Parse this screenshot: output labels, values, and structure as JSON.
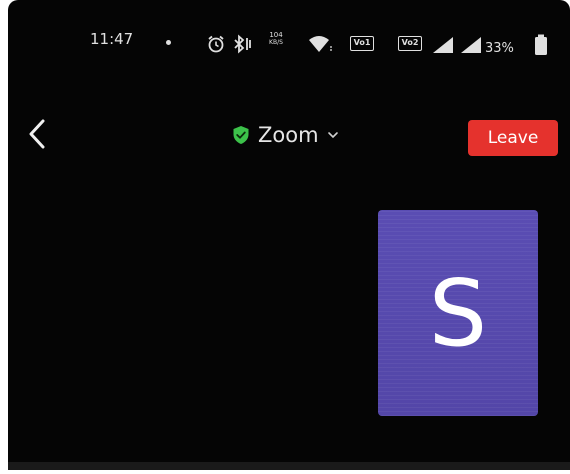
{
  "status_bar": {
    "time": "11:47",
    "net_speed_value": "104",
    "net_speed_unit": "KB/S",
    "sim1_label": "Vo1",
    "sim2_label": "Vo2",
    "battery_percent": "33%",
    "icons": [
      "alarm-icon",
      "bluetooth-icon",
      "wifi-icon",
      "signal-icon",
      "signal-icon",
      "battery-icon"
    ]
  },
  "header": {
    "meeting_name": "Zoom",
    "leave_label": "Leave"
  },
  "participant": {
    "initial": "S"
  },
  "colors": {
    "background": "#050505",
    "leave": "#e5322d",
    "shield": "#3cc24a",
    "avatar_tile": "#5b4bb0"
  }
}
